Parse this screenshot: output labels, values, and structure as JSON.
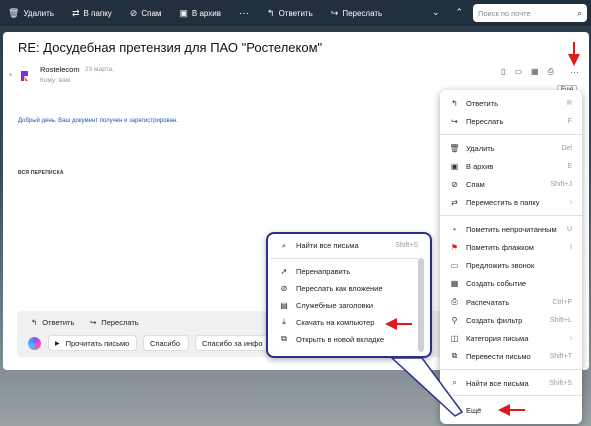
{
  "toolbar": {
    "delete": "Удалить",
    "to_folder": "В папку",
    "spam": "Спам",
    "archive": "В архив",
    "more_dots": "···",
    "reply": "Ответить",
    "forward": "Переслать",
    "search_placeholder": "Поиск по почте"
  },
  "letter": {
    "subject": "RE: Досудебная претензия для ПАО \"Ростелеком\"",
    "sender": "Rostelecom",
    "date": "23 марта,",
    "to": "Кому: вам",
    "more_dots": "···",
    "tooltip": "Ещё",
    "body": "Добрый день. Ваш документ получен и зарегистрирован.",
    "thread_label": "ВСЯ ПЕРЕПИСКА"
  },
  "reply_bar": {
    "reply": "Ответить",
    "forward": "Переслать",
    "chips": [
      "Прочитать письмо",
      "Спасибо",
      "Спасибо за инфо"
    ]
  },
  "menu": {
    "items": [
      {
        "icon": "reply-icon",
        "glyph": "↰",
        "label": "Ответить",
        "shortcut": "R"
      },
      {
        "icon": "forward-icon",
        "glyph": "↪",
        "label": "Переслать",
        "shortcut": "F"
      },
      {
        "icon": "trash-icon",
        "glyph": "🗑",
        "label": "Удалить",
        "shortcut": "Del"
      },
      {
        "icon": "archive-icon",
        "glyph": "▣",
        "label": "В архив",
        "shortcut": "E"
      },
      {
        "icon": "spam-icon",
        "glyph": "⊘",
        "label": "Спам",
        "shortcut": "Shift+J"
      },
      {
        "icon": "move-folder-icon",
        "glyph": "⇄",
        "label": "Переместить в папку",
        "shortcut": "›"
      },
      {
        "icon": "unread-dot-icon",
        "glyph": "•",
        "label": "Пометить непрочитанным",
        "shortcut": "U"
      },
      {
        "icon": "flag-icon",
        "glyph": "⚑",
        "label": "Пометить флажком",
        "shortcut": "I"
      },
      {
        "icon": "video-call-icon",
        "glyph": "▭",
        "label": "Предложить звонок",
        "shortcut": ""
      },
      {
        "icon": "calendar-icon",
        "glyph": "▦",
        "label": "Создать событие",
        "shortcut": ""
      },
      {
        "icon": "print-icon",
        "glyph": "⎙",
        "label": "Распечатать",
        "shortcut": "Ctrl+P"
      },
      {
        "icon": "filter-icon",
        "glyph": "⚲",
        "label": "Создать фильтр",
        "shortcut": "Shift+L"
      },
      {
        "icon": "category-icon",
        "glyph": "◫",
        "label": "Категория письма",
        "shortcut": "›"
      },
      {
        "icon": "translate-icon",
        "glyph": "⧉",
        "label": "Перевести письмо",
        "shortcut": "Shift+T"
      },
      {
        "icon": "search-icon",
        "glyph": "⌕",
        "label": "Найти все письма",
        "shortcut": "Shift+S"
      },
      {
        "icon": "chevron-down-icon",
        "glyph": "⌄",
        "label": "Ещё",
        "shortcut": ""
      }
    ]
  },
  "submenu": {
    "top": {
      "icon": "search-icon",
      "glyph": "⌕",
      "label": "Найти все письма",
      "shortcut": "Shift+S"
    },
    "items": [
      {
        "icon": "redirect-icon",
        "glyph": "➚",
        "label": "Перенаправить"
      },
      {
        "icon": "attachment-icon",
        "glyph": "⊘",
        "label": "Переслать как вложение"
      },
      {
        "icon": "headers-icon",
        "glyph": "▤",
        "label": "Служебные заголовки"
      },
      {
        "icon": "download-icon",
        "glyph": "⤓",
        "label": "Скачать на компьютер"
      },
      {
        "icon": "new-tab-icon",
        "glyph": "⧉",
        "label": "Открыть в новой вкладке"
      }
    ]
  },
  "colors": {
    "toolbar_bg": "#22303d",
    "submenu_border": "#2b2f8a",
    "annotation_arrow": "#e0191f",
    "link_text": "#1a5bb8",
    "flag": "#e0191f",
    "unread_dot": "#2f6fe0"
  }
}
